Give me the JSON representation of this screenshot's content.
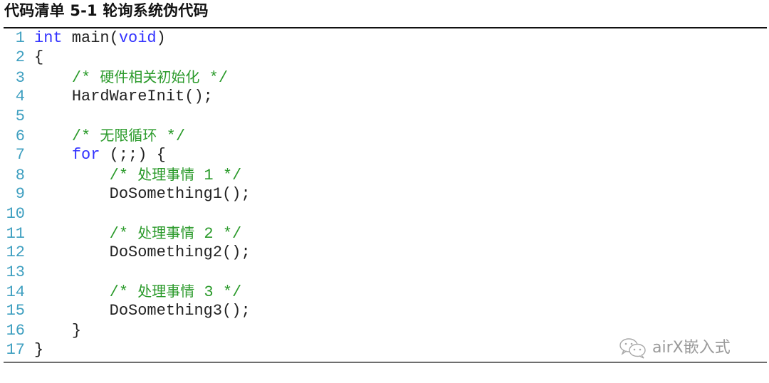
{
  "caption": "代码清单 5-1 轮询系统伪代码",
  "code": {
    "language": "c",
    "lines": [
      {
        "num": "1",
        "indent": "",
        "tokens": [
          {
            "t": "kw",
            "v": "int"
          },
          {
            "t": "tx",
            "v": " main("
          },
          {
            "t": "kw",
            "v": "void"
          },
          {
            "t": "tx",
            "v": ")"
          }
        ]
      },
      {
        "num": "2",
        "indent": "",
        "tokens": [
          {
            "t": "tx",
            "v": "{"
          }
        ]
      },
      {
        "num": "3",
        "indent": "    ",
        "tokens": [
          {
            "t": "cm",
            "v": "/* 硬件相关初始化 */"
          }
        ]
      },
      {
        "num": "4",
        "indent": "    ",
        "tokens": [
          {
            "t": "tx",
            "v": "HardWareInit();"
          }
        ]
      },
      {
        "num": "5",
        "indent": "",
        "tokens": []
      },
      {
        "num": "6",
        "indent": "    ",
        "tokens": [
          {
            "t": "cm",
            "v": "/* 无限循环 */"
          }
        ]
      },
      {
        "num": "7",
        "indent": "    ",
        "tokens": [
          {
            "t": "kw",
            "v": "for"
          },
          {
            "t": "tx",
            "v": " (;;) {"
          }
        ]
      },
      {
        "num": "8",
        "indent": "        ",
        "tokens": [
          {
            "t": "cm",
            "v": "/* 处理事情 1 */"
          }
        ]
      },
      {
        "num": "9",
        "indent": "        ",
        "tokens": [
          {
            "t": "tx",
            "v": "DoSomething1();"
          }
        ]
      },
      {
        "num": "10",
        "indent": "",
        "tokens": []
      },
      {
        "num": "11",
        "indent": "        ",
        "tokens": [
          {
            "t": "cm",
            "v": "/* 处理事情 2 */"
          }
        ]
      },
      {
        "num": "12",
        "indent": "        ",
        "tokens": [
          {
            "t": "tx",
            "v": "DoSomething2();"
          }
        ]
      },
      {
        "num": "13",
        "indent": "",
        "tokens": []
      },
      {
        "num": "14",
        "indent": "        ",
        "tokens": [
          {
            "t": "cm",
            "v": "/* 处理事情 3 */"
          }
        ]
      },
      {
        "num": "15",
        "indent": "        ",
        "tokens": [
          {
            "t": "tx",
            "v": "DoSomething3();"
          }
        ]
      },
      {
        "num": "16",
        "indent": "    ",
        "tokens": [
          {
            "t": "tx",
            "v": "}"
          }
        ]
      },
      {
        "num": "17",
        "indent": "",
        "tokens": [
          {
            "t": "tx",
            "v": "}"
          }
        ]
      }
    ]
  },
  "watermark": {
    "icon": "wechat-icon",
    "text": "airX嵌入式"
  },
  "colors": {
    "keyword": "#3232ff",
    "comment": "#2a9a2a",
    "line_number": "#3e9fc0",
    "text": "#222222"
  }
}
